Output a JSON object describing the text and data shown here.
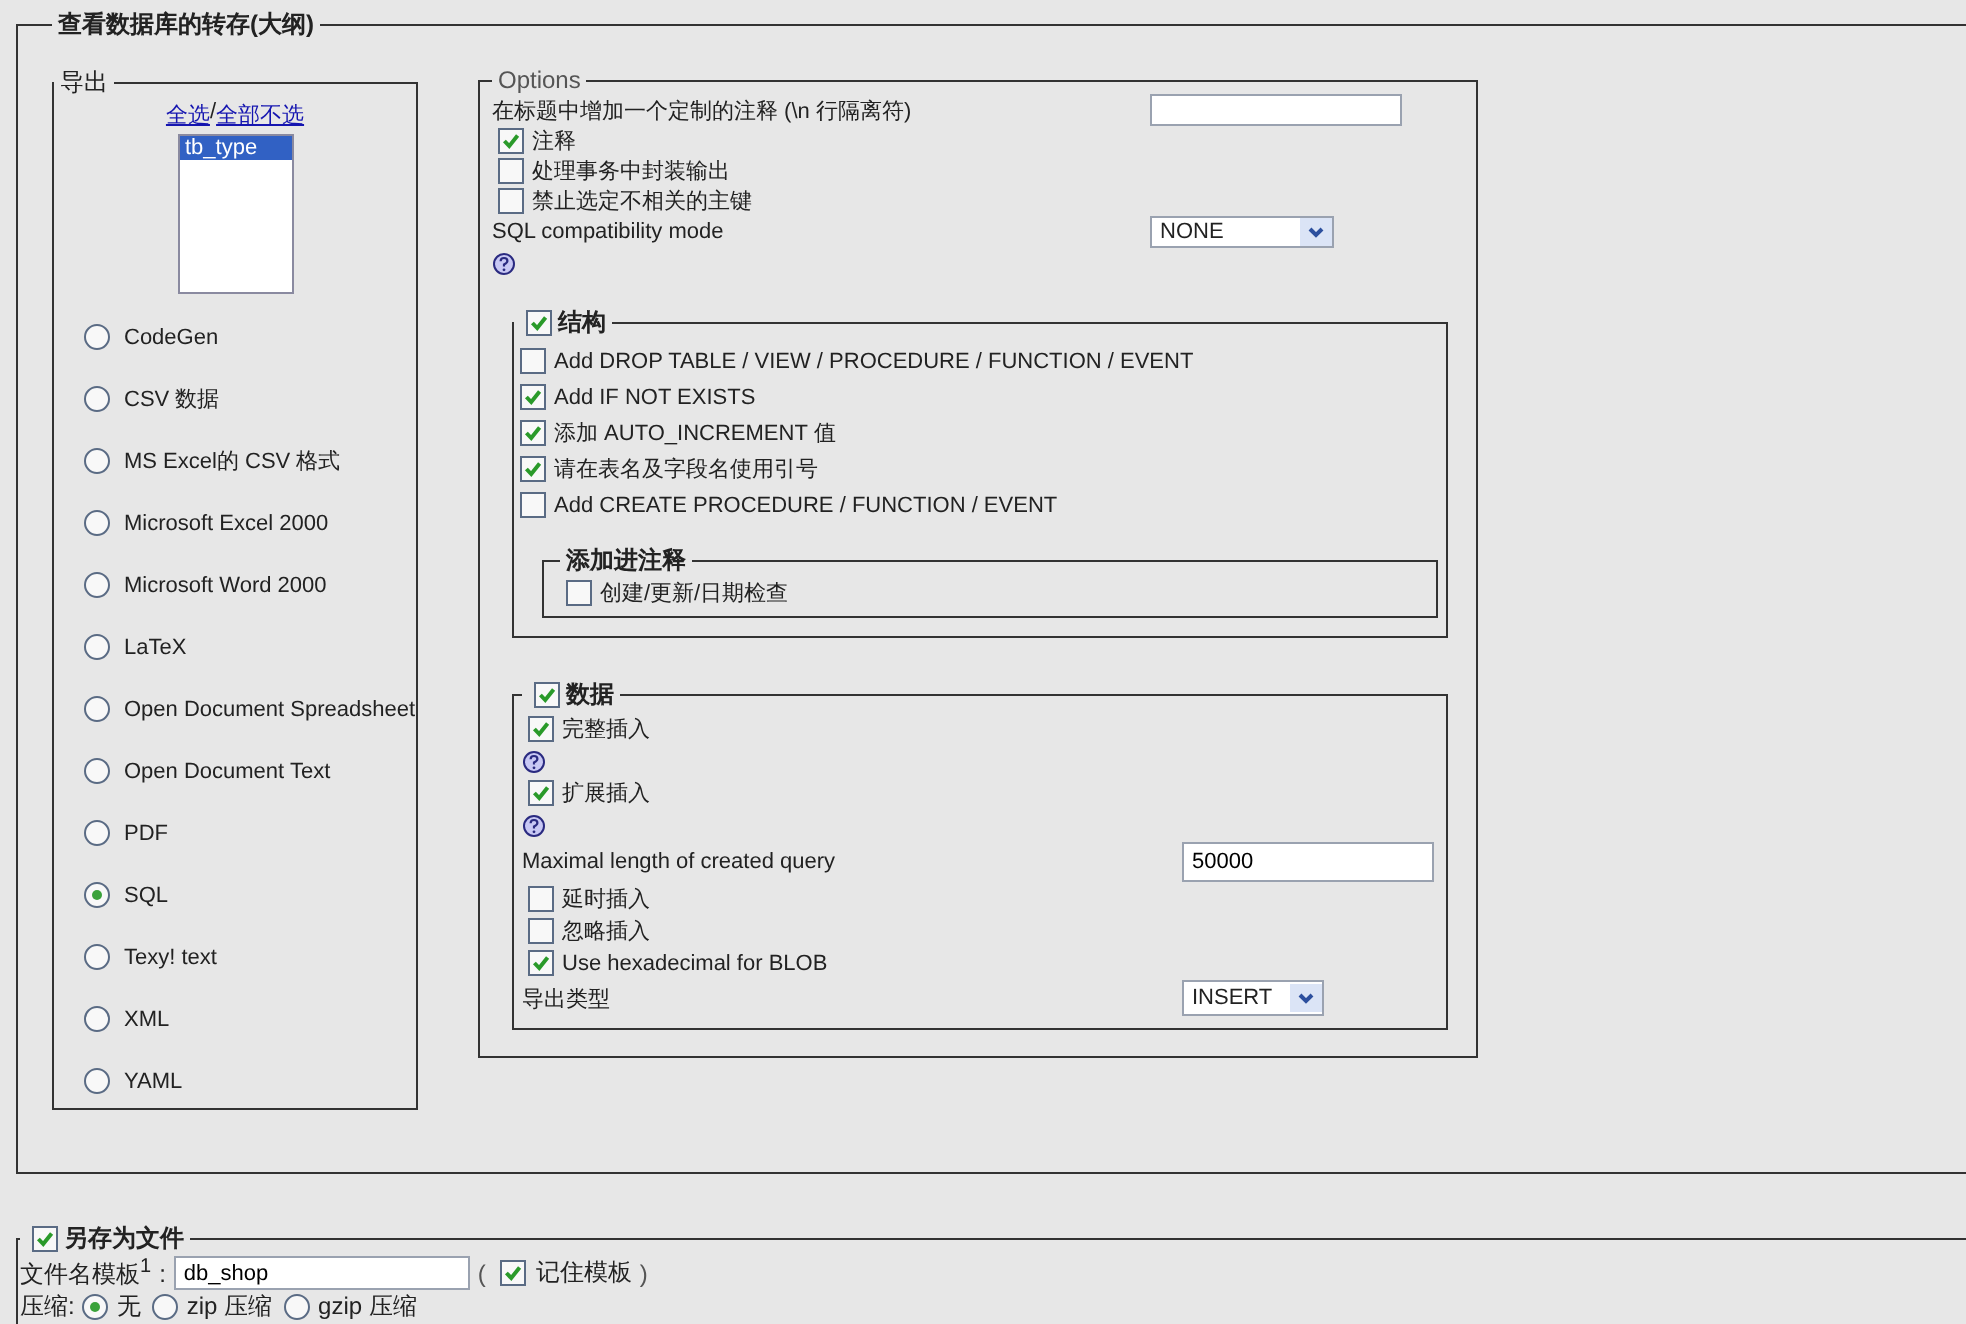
{
  "dump": {
    "title": "查看数据库的转存(大纲)"
  },
  "export": {
    "title": "导出",
    "select_all": "全选",
    "separator": " / ",
    "select_none": "全部不选",
    "tables": [
      {
        "name": "tb_type",
        "selected": true
      }
    ],
    "formats": [
      {
        "label": "CodeGen",
        "selected": false
      },
      {
        "label": "CSV 数据",
        "selected": false
      },
      {
        "label": "MS Excel的 CSV 格式",
        "selected": false
      },
      {
        "label": "Microsoft Excel 2000",
        "selected": false
      },
      {
        "label": "Microsoft Word 2000",
        "selected": false
      },
      {
        "label": "LaTeX",
        "selected": false
      },
      {
        "label": "Open Document Spreadsheet",
        "selected": false
      },
      {
        "label": "Open Document Text",
        "selected": false
      },
      {
        "label": "PDF",
        "selected": false
      },
      {
        "label": "SQL",
        "selected": true
      },
      {
        "label": "Texy! text",
        "selected": false
      },
      {
        "label": "XML",
        "selected": false
      },
      {
        "label": "YAML",
        "selected": false
      }
    ]
  },
  "options": {
    "title": "Options",
    "rows": [
      {
        "kind": "field",
        "label": "在标题中增加一个定制的注释 (\\n 行隔离符)"
      },
      {
        "kind": "checkbox",
        "label": "注释",
        "checked": true
      },
      {
        "kind": "checkbox",
        "label": "处理事务中封装输出",
        "checked": false
      },
      {
        "kind": "checkbox",
        "label": "禁止选定不相关的主键",
        "checked": false
      },
      {
        "kind": "select",
        "label": "SQL compatibility mode",
        "value": "NONE"
      },
      {
        "kind": "help"
      }
    ],
    "structure": {
      "title": "结构",
      "checked": true,
      "rows": [
        {
          "kind": "checkbox",
          "label": "Add DROP TABLE / VIEW / PROCEDURE / FUNCTION / EVENT",
          "checked": false
        },
        {
          "kind": "checkbox",
          "label": "Add IF NOT EXISTS",
          "checked": true
        },
        {
          "kind": "checkbox",
          "label": "添加 AUTO_INCREMENT 值",
          "checked": true
        },
        {
          "kind": "checkbox",
          "label": "请在表名及字段名使用引号",
          "checked": true
        },
        {
          "kind": "checkbox",
          "label": "Add CREATE PROCEDURE / FUNCTION / EVENT",
          "checked": false
        }
      ],
      "comments": {
        "title": "添加进注释",
        "rows": [
          {
            "kind": "checkbox",
            "label": "创建/更新/日期检查",
            "checked": false
          }
        ]
      }
    },
    "data": {
      "title": "数据",
      "checked": true,
      "rows": [
        {
          "kind": "checkbox",
          "label": "完整插入",
          "checked": true
        },
        {
          "kind": "help"
        },
        {
          "kind": "checkbox",
          "label": "扩展插入",
          "checked": true
        },
        {
          "kind": "help"
        },
        {
          "kind": "field",
          "label": "Maximal length of created query",
          "value": "50000"
        },
        {
          "kind": "checkbox",
          "label": "延时插入",
          "checked": false
        },
        {
          "kind": "checkbox",
          "label": "忽略插入",
          "checked": false
        },
        {
          "kind": "checkbox",
          "label": "Use hexadecimal for BLOB",
          "checked": true
        },
        {
          "kind": "select",
          "label": "导出类型",
          "value": "INSERT"
        }
      ]
    }
  },
  "save_as_file": {
    "title": "另存为文件",
    "checked": true,
    "filename_label": "文件名模板$^{1}$",
    "colon": ":",
    "filename_value": "db_shop",
    "open_paren": "(",
    "remember_label": "记住模板",
    "remember_checked": true,
    "close_paren": ")",
    "compression_label": "压缩:",
    "compression": [
      {
        "label": "无",
        "selected": true
      },
      {
        "label": "zip 压缩",
        "selected": false
      },
      {
        "label": "gzip 压缩",
        "selected": false
      }
    ]
  }
}
